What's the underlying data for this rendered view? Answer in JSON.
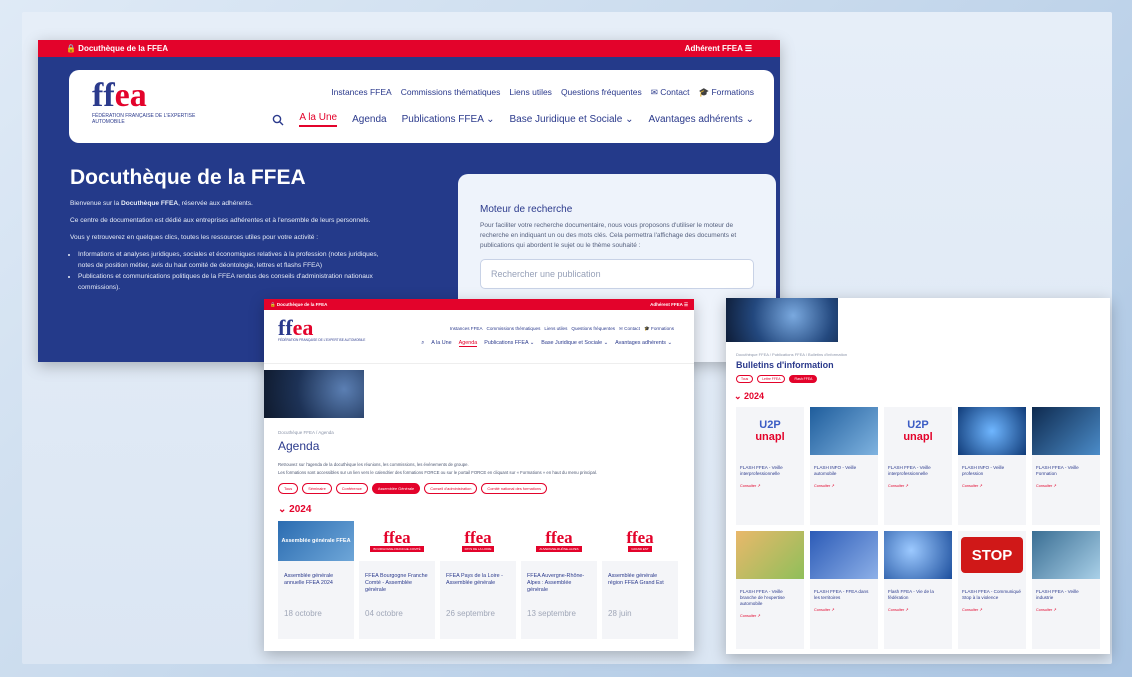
{
  "shot1": {
    "topbar_left": "🔒 Docuthèque de la FFEA",
    "topbar_right": "Adhérent FFEA ☰",
    "logo_mark_a": "ff",
    "logo_mark_b": "ea",
    "logo_tagline": "FÉDÉRATION FRANÇAISE DE L'EXPERTISE AUTOMOBILE",
    "nav_top": [
      "Instances FFEA",
      "Commissions thématiques",
      "Liens utiles",
      "Questions fréquentes",
      "✉ Contact",
      "🎓 Formations"
    ],
    "nav_main": [
      "A la Une",
      "Agenda",
      "Publications FFEA ⌄",
      "Base Juridique et Sociale ⌄",
      "Avantages adhérents ⌄"
    ],
    "search_icon": "search-icon",
    "title": "Docuthèque de la FFEA",
    "intro_p1_a": "Bienvenue sur la ",
    "intro_p1_b": "Docuthèque FFEA",
    "intro_p1_c": ", réservée aux adhérents.",
    "intro_p2": "Ce centre de documentation est dédié aux entreprises adhérentes et à l'ensemble de leurs personnels.",
    "intro_p3": "Vous y retrouverez en quelques clics, toutes les ressources utiles pour votre activité :",
    "bullets": [
      "Informations et analyses juridiques, sociales et économiques relatives à la profession (notes juridiques, notes de position métier, avis du haut comité de déontologie, lettres et flashs FFEA)",
      "Publications et communications politiques de la FFEA rendus des conseils d'administration nationaux commissions)."
    ],
    "search_title": "Moteur de recherche",
    "search_desc": "Pour faciliter votre recherche documentaire, nous vous proposons d'utiliser le moteur de recherche en indiquant un ou des mots clés. Cela permettra l'affichage des documents et publications qui abordent le sujet ou le thème souhaité :",
    "search_placeholder": "Rechercher une publication"
  },
  "shot2": {
    "topbar_left": "🔒 Docuthèque de la FFEA",
    "topbar_right": "Adhérent FFEA ☰",
    "nav_top": [
      "Instances FFEA",
      "Commissions thématiques",
      "Liens utiles",
      "Questions fréquentes",
      "✉ Contact",
      "🎓 Formations"
    ],
    "nav_main": [
      "A la Une",
      "Agenda",
      "Publications FFEA ⌄",
      "Base Juridique et Sociale ⌄",
      "Avantages adhérents ⌄"
    ],
    "breadcrumb": "Docuthèque FFEA  /  Agenda",
    "title": "Agenda",
    "desc1": "Retrouvez sur l'agenda de la docuthèque les réunions, les commissions, les événements de groupe.",
    "desc2": "Les formations sont accessibles sur un lien vers le calendrier des formations FORCE ou sur le portail FORCE en cliquant sur « Formations » en haut du menu principal.",
    "filters": [
      "Tous",
      "Séminaire",
      "Conférence",
      "Assemblée Générale",
      "Conseil d'administration",
      "Comité national des formations"
    ],
    "active_filter": "Assemblée Générale",
    "year": "⌄ 2024",
    "cards": [
      {
        "img": "Assemblée générale FFEA",
        "title": "Assemblée générale annuelle FFEA 2024",
        "date": "18 octobre"
      },
      {
        "img": "BOURGOGNE-FRANCHE-COMTÉ",
        "title": "FFEA Bourgogne Franche Comté - Assemblée générale",
        "date": "04 octobre"
      },
      {
        "img": "PAYS DE LA LOIRE",
        "title": "FFEA Pays de la Loire - Assemblée générale",
        "date": "26 septembre"
      },
      {
        "img": "AUVERGNE-RHÔNE-ALPES",
        "title": "FFEA Auvergne-Rhône-Alpes : Assemblée générale",
        "date": "13 septembre"
      },
      {
        "img": "GRAND EST",
        "title": "Assemblée générale région FFEA Grand Est",
        "date": "28 juin"
      }
    ]
  },
  "shot3": {
    "breadcrumb": "Docuthèque FFEA  /  Publications FFEA  /  Bulletins d'information",
    "title": "Bulletins d'information",
    "filters": [
      "Tous",
      "Lettre FFEA",
      "Flash FFEA"
    ],
    "active_filter": "Flash FFEA",
    "year": "⌄ 2024",
    "more_label": "Consulter ↗",
    "cards": [
      {
        "img": "u2p",
        "title": "FLASH FFEA - Veille interprofessionnelle"
      },
      {
        "img": "photo-blue",
        "title": "FLASH INFO - Veille automobile"
      },
      {
        "img": "u2p",
        "title": "FLASH FFEA - Veille interprofessionnelle"
      },
      {
        "img": "photo-tech",
        "title": "FLASH INFO - Veille profession"
      },
      {
        "img": "photo-dark",
        "title": "FLASH FFEA - Veille Formation"
      },
      {
        "img": "photo-warm",
        "title": "FLASH FFEA - Veille branche de l'expertise automobile"
      },
      {
        "img": "photo-map",
        "title": "FLASH FFEA - FFEA dans les territoires"
      },
      {
        "img": "photo-bubbles",
        "title": "Flash FFEA - Vie de la fédération"
      },
      {
        "img": "stop",
        "title": "FLASH FFEA - Communiqué Stop à la violence"
      },
      {
        "img": "photo-industry",
        "title": "FLASH FFEA - Veille industrie"
      }
    ],
    "u2p_top": "U2P",
    "u2p_bottom": "unapl",
    "stop_text": "STOP"
  }
}
